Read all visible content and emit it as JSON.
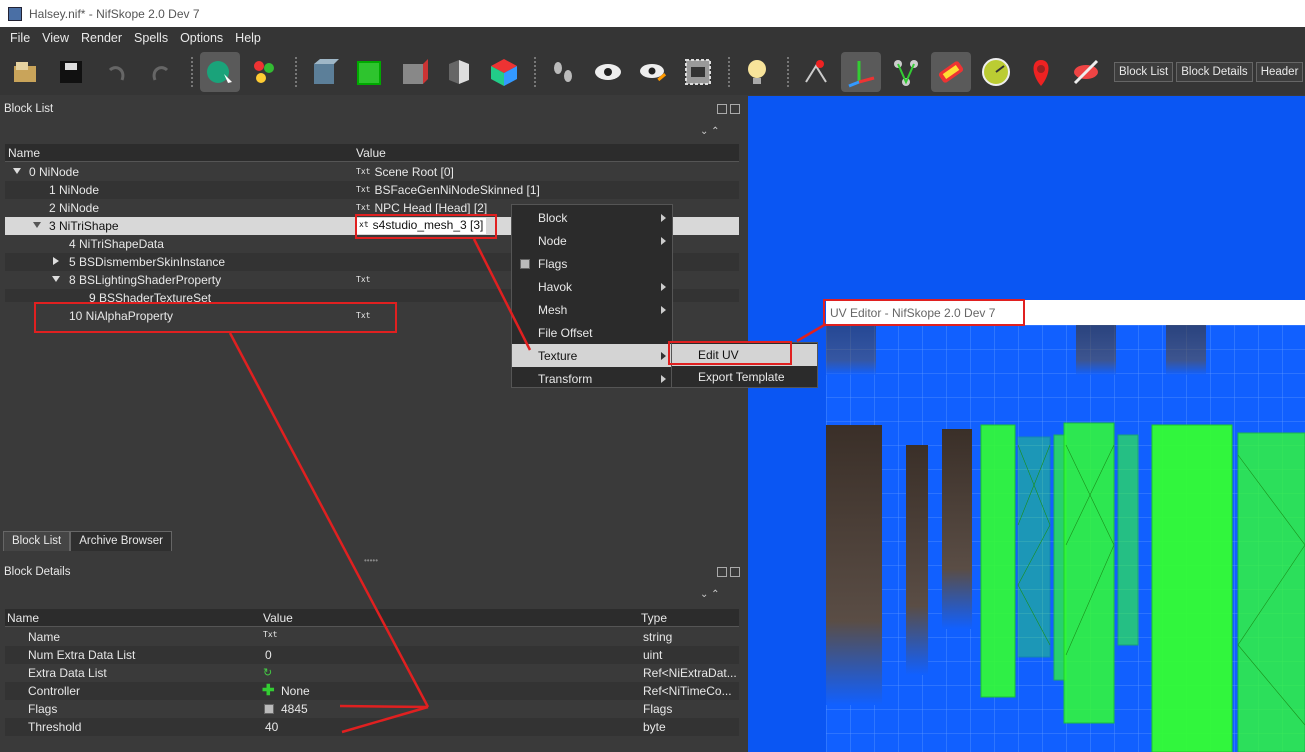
{
  "window": {
    "title": "Halsey.nif* - NifSkope 2.0 Dev 7"
  },
  "menu": [
    "File",
    "View",
    "Render",
    "Spells",
    "Options",
    "Help"
  ],
  "toolbar": {
    "icons": [
      "open-icon",
      "save-icon",
      "undo-icon",
      "redo-icon",
      "select-icon",
      "select-multi-icon",
      "box-icon",
      "green-box-icon",
      "gray-box-icon",
      "half-box-icon",
      "color-box-icon",
      "footprints-icon",
      "eye-icon",
      "eye-edit-icon",
      "camera-icon",
      "light-icon",
      "vertex-icon",
      "axes-icon",
      "bones-icon",
      "texture-icon",
      "gauge-icon",
      "marker-icon",
      "hide-icon"
    ],
    "text_buttons": [
      "Block List",
      "Block Details",
      "Header"
    ]
  },
  "block_list": {
    "title": "Block List",
    "columns": [
      "Name",
      "Value"
    ],
    "rows": [
      {
        "name": "0 NiNode",
        "txt": "Txt",
        "value": "Scene Root [0]"
      },
      {
        "name": "1 NiNode",
        "txt": "Txt",
        "value": "BSFaceGenNiNodeSkinned [1]"
      },
      {
        "name": "2 NiNode",
        "txt": "Txt",
        "value": "NPC Head [Head] [2]"
      },
      {
        "name": "3 NiTriShape",
        "txt": "xt",
        "value": "s4studio_mesh_3 [3]"
      },
      {
        "name": "4 NiTriShapeData",
        "txt": "",
        "value": ""
      },
      {
        "name": "5 BSDismemberSkinInstance",
        "txt": "",
        "value": ""
      },
      {
        "name": "8 BSLightingShaderProperty",
        "txt": "Txt",
        "value": ""
      },
      {
        "name": "9 BSShaderTextureSet",
        "txt": "",
        "value": ""
      },
      {
        "name": "10 NiAlphaProperty",
        "txt": "Txt",
        "value": ""
      }
    ]
  },
  "tabs": [
    "Block List",
    "Archive Browser"
  ],
  "block_details": {
    "title": "Block Details",
    "columns": [
      "Name",
      "Value",
      "Type"
    ],
    "rows": [
      {
        "name": "Name",
        "value": "Txt",
        "type": "string"
      },
      {
        "name": "Num Extra Data List",
        "value": "0",
        "type": "uint"
      },
      {
        "name": "Extra Data List",
        "value": "",
        "type": "Ref<NiExtraDat..."
      },
      {
        "name": "Controller",
        "value": "None",
        "type": "Ref<NiTimeCo..."
      },
      {
        "name": "Flags",
        "value": "4845",
        "type": "Flags"
      },
      {
        "name": "Threshold",
        "value": "40",
        "type": "byte"
      }
    ]
  },
  "context_menu": {
    "items": [
      "Block",
      "Node",
      "Flags",
      "Havok",
      "Mesh",
      "File Offset",
      "Texture",
      "Transform"
    ],
    "submenu": [
      "Edit UV",
      "Export Template"
    ]
  },
  "uv_editor": {
    "title": "UV Editor - NifSkope 2.0 Dev 7"
  },
  "colors": {
    "viewport": "#0a56f3",
    "uv_mesh": "#33ff33",
    "annotation": "#e02020"
  }
}
